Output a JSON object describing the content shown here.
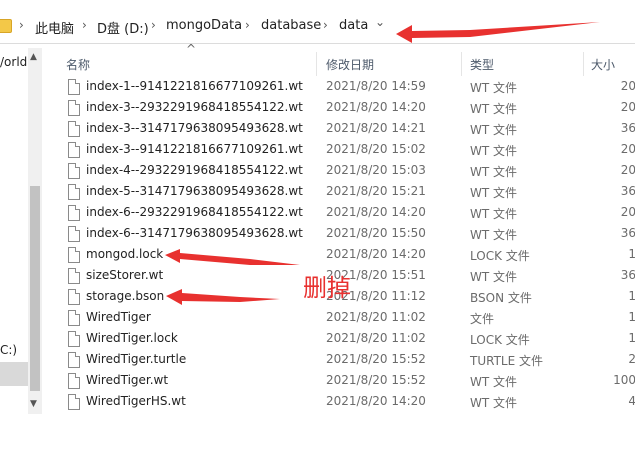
{
  "address_bar": {
    "crumbs": [
      "此电脑",
      "D盘 (D:)",
      "mongoData",
      "database",
      "data"
    ],
    "separator": "›",
    "dropdown": "⌄"
  },
  "nav": {
    "partial_item_1": "/orld",
    "partial_item_2": "C:)",
    "scroll_up": "▲",
    "scroll_down": "▼"
  },
  "columns": {
    "name": "名称",
    "date": "修改日期",
    "type": "类型",
    "size": "大小",
    "sort_indicator": "^"
  },
  "files": [
    {
      "name": "index-1--9141221816677109261.wt",
      "date": "2021/8/20 14:59",
      "type": "WT 文件",
      "size": "20"
    },
    {
      "name": "index-3--2932291968418554122.wt",
      "date": "2021/8/20 14:20",
      "type": "WT 文件",
      "size": "20"
    },
    {
      "name": "index-3--3147179638095493628.wt",
      "date": "2021/8/20 14:21",
      "type": "WT 文件",
      "size": "36"
    },
    {
      "name": "index-3--9141221816677109261.wt",
      "date": "2021/8/20 15:02",
      "type": "WT 文件",
      "size": "20"
    },
    {
      "name": "index-4--2932291968418554122.wt",
      "date": "2021/8/20 15:03",
      "type": "WT 文件",
      "size": "20"
    },
    {
      "name": "index-5--3147179638095493628.wt",
      "date": "2021/8/20 15:21",
      "type": "WT 文件",
      "size": "36"
    },
    {
      "name": "index-6--2932291968418554122.wt",
      "date": "2021/8/20 14:20",
      "type": "WT 文件",
      "size": "20"
    },
    {
      "name": "index-6--3147179638095493628.wt",
      "date": "2021/8/20 15:50",
      "type": "WT 文件",
      "size": "36"
    },
    {
      "name": "mongod.lock",
      "date": "2021/8/20 14:20",
      "type": "LOCK 文件",
      "size": "1"
    },
    {
      "name": "sizeStorer.wt",
      "date": "2021/8/20 15:51",
      "type": "WT 文件",
      "size": "36"
    },
    {
      "name": "storage.bson",
      "date": "2021/8/20 11:12",
      "type": "BSON 文件",
      "size": "1"
    },
    {
      "name": "WiredTiger",
      "date": "2021/8/20 11:02",
      "type": "文件",
      "size": "1"
    },
    {
      "name": "WiredTiger.lock",
      "date": "2021/8/20 11:02",
      "type": "LOCK 文件",
      "size": "1"
    },
    {
      "name": "WiredTiger.turtle",
      "date": "2021/8/20 15:52",
      "type": "TURTLE 文件",
      "size": "2"
    },
    {
      "name": "WiredTiger.wt",
      "date": "2021/8/20 15:52",
      "type": "WT 文件",
      "size": "100"
    },
    {
      "name": "WiredTigerHS.wt",
      "date": "2021/8/20 14:20",
      "type": "WT 文件",
      "size": "4"
    }
  ],
  "annotation": {
    "text": "删掉",
    "color": "#e8312f"
  }
}
